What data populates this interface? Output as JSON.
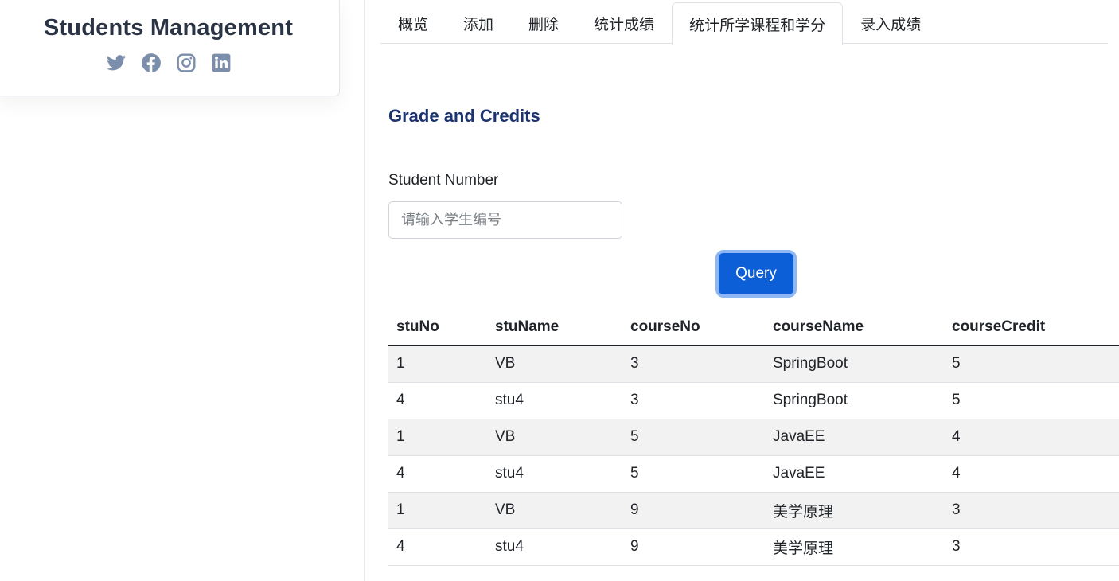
{
  "sidebar": {
    "brand_title": "Students Management",
    "social_icons": [
      "twitter-icon",
      "facebook-icon",
      "instagram-icon",
      "linkedin-icon"
    ],
    "icon_color": "#7b8eab"
  },
  "tabs": [
    {
      "label": "概览",
      "active": false
    },
    {
      "label": "添加",
      "active": false
    },
    {
      "label": "删除",
      "active": false
    },
    {
      "label": "统计成绩",
      "active": false
    },
    {
      "label": "统计所学课程和学分",
      "active": true
    },
    {
      "label": "录入成绩",
      "active": false
    }
  ],
  "section": {
    "title": "Grade and Credits"
  },
  "form": {
    "label": "Student Number",
    "placeholder": "请输入学生编号",
    "value": "",
    "button_label": "Query"
  },
  "table": {
    "columns": [
      "stuNo",
      "stuName",
      "courseNo",
      "courseName",
      "courseCredit"
    ],
    "rows": [
      [
        "1",
        "VB",
        "3",
        "SpringBoot",
        "5"
      ],
      [
        "4",
        "stu4",
        "3",
        "SpringBoot",
        "5"
      ],
      [
        "1",
        "VB",
        "5",
        "JavaEE",
        "4"
      ],
      [
        "4",
        "stu4",
        "5",
        "JavaEE",
        "4"
      ],
      [
        "1",
        "VB",
        "9",
        "美学原理",
        "3"
      ],
      [
        "4",
        "stu4",
        "9",
        "美学原理",
        "3"
      ]
    ]
  },
  "colors": {
    "accent": "#0d5fd8",
    "title": "#1c3370",
    "brand": "#2b3445"
  }
}
